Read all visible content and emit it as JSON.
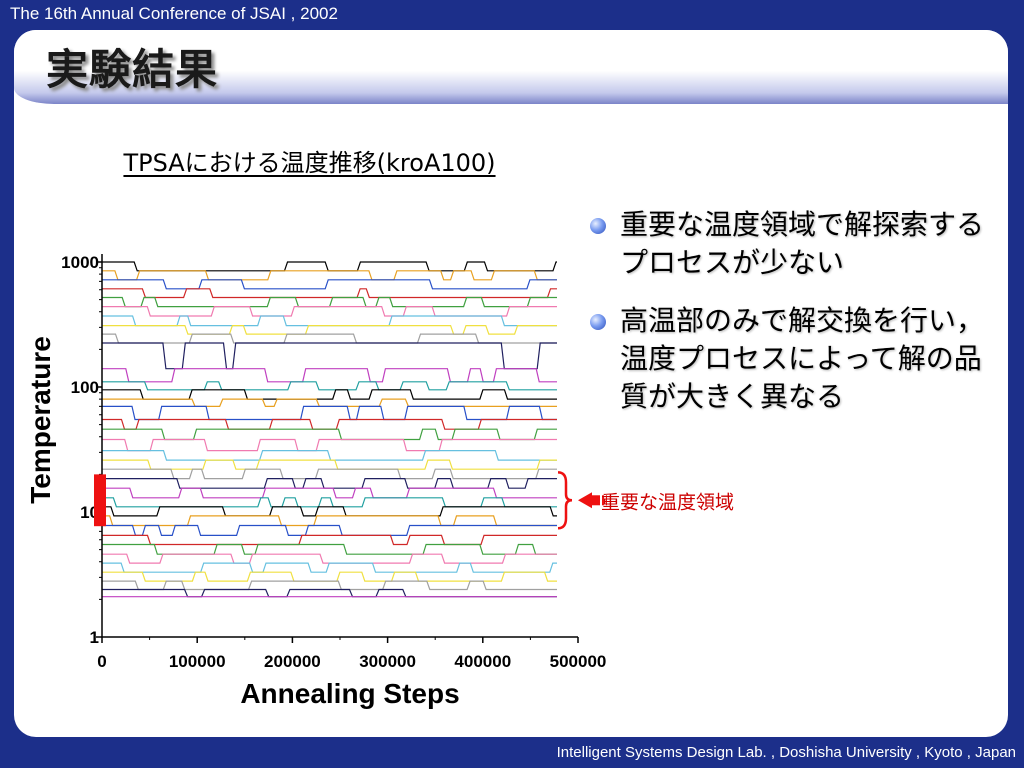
{
  "header": {
    "conference": "The 16th Annual Conference of JSAI , 2002",
    "footer": "Intelligent Systems Design Lab. , Doshisha University , Kyoto , Japan"
  },
  "slide": {
    "title": "実験結果",
    "bullets": [
      "重要な温度領域で解探索するプロセスが少ない",
      "高温部のみで解交換を行い，温度プロセスによって解の品質が大きく異なる"
    ]
  },
  "chart_data": {
    "type": "line",
    "title": "TPSAにおける温度推移(kroA100)",
    "xlabel": "Annealing Steps",
    "ylabel": "Temperature",
    "xlim": [
      0,
      500000
    ],
    "ylim": [
      1,
      1000
    ],
    "yscale": "log",
    "xticks": [
      "0",
      "100000",
      "200000",
      "300000",
      "400000",
      "500000"
    ],
    "yticks": [
      "1",
      "10",
      "100",
      "1000"
    ],
    "grid": false,
    "legend": "none",
    "annotation": "重要な温度領域",
    "highlight_range": [
      7.7,
      20
    ],
    "colors": {
      "highlight": "#ee1111",
      "annotation": "#cc0000",
      "series": [
        "#000000",
        "#e8a020",
        "#2850c8",
        "#d02828",
        "#40a040",
        "#f07ab0",
        "#66c0e0",
        "#f0e040",
        "#a0a0a0",
        "#202060",
        "#c040c0",
        "#20a0a0"
      ]
    },
    "temperature_levels": [
      1000,
      850,
      720,
      610,
      520,
      440,
      370,
      310,
      265,
      225,
      140,
      110,
      95,
      80,
      70,
      55,
      46,
      38,
      31,
      26,
      22,
      18.5,
      15.5,
      13,
      11,
      9.3,
      7.8,
      6.5,
      5.5,
      4.6,
      3.9,
      3.3,
      2.8,
      2.4,
      2.1
    ],
    "series_note": "Temperature trace of each of the 35 parallel annealing processes; each process swaps between neighbouring temperature levels over the run."
  }
}
